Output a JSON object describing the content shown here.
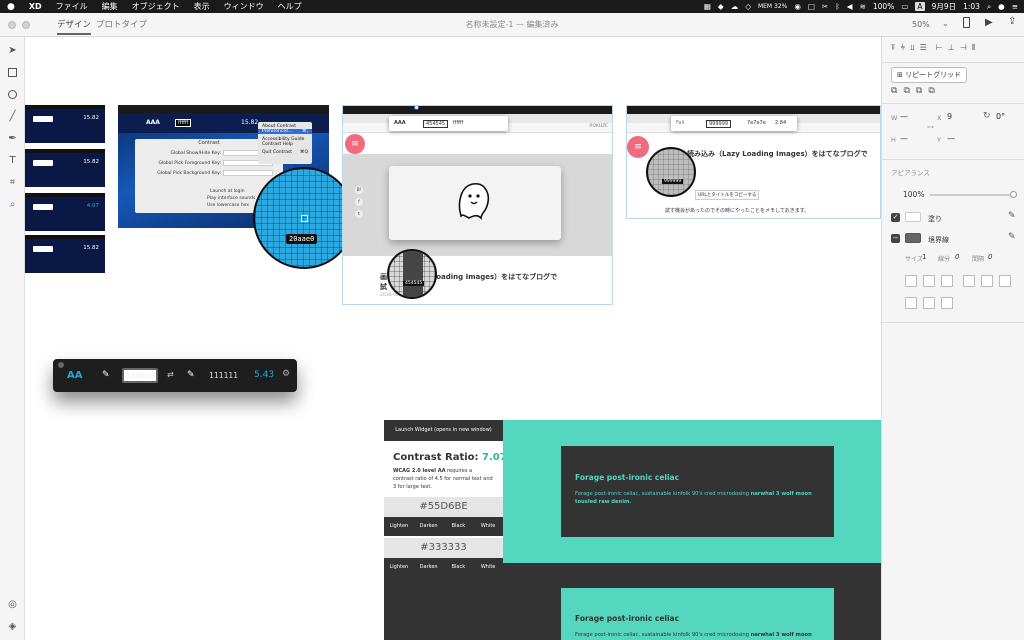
{
  "menubar": {
    "app": "XD",
    "items": [
      "ファイル",
      "編集",
      "オブジェクト",
      "表示",
      "ウィンドウ",
      "ヘルプ"
    ],
    "memory": "MEM 32%",
    "battery": "100%",
    "date": "9月9日",
    "time": "1:03"
  },
  "titlebar": {
    "tabs": [
      "デザイン",
      "プロトタイプ"
    ],
    "doc_title": "名称未設定-1 — 編集済み",
    "zoom": "50%"
  },
  "inspector": {
    "repeat_grid": "リピートグリッド",
    "w_label": "W",
    "w_value": "—",
    "h_label": "H",
    "h_value": "—",
    "x_label": "X",
    "x_value": "9",
    "y_label": "Y",
    "y_value": "—",
    "rotation": "0°",
    "appearance": "アピアランス",
    "opacity": "100%",
    "fill_label": "塗り",
    "border_label": "境界線",
    "size_label": "サイズ",
    "size_value": "1",
    "gap_label": "線分",
    "gap_value": "0",
    "interval_label": "間隔",
    "interval_value": "0"
  },
  "canvas": {
    "mini_values": [
      "15.82",
      "15.82",
      "4.07",
      "15.82"
    ],
    "contrast_dialog": {
      "title": "Contrast",
      "rows": [
        "Global Show/Hide Key:",
        "Global Pick Foreground Key:",
        "Global Pick Background Key:"
      ],
      "launch": "Launch at login",
      "sound": "Play interface sounds",
      "lower": "Use lowercase hex"
    },
    "context_menu": [
      "About Contrast",
      "Preferences...",
      "Accessibility Guide",
      "Contrast Help",
      "Quit Contrast"
    ],
    "context_shortcuts": [
      "",
      "⌘,",
      "",
      "",
      "⌘Q"
    ],
    "mini_toolbar": {
      "aaa": "AAA",
      "fg": "ffffff",
      "bg": "454545",
      "ratio": "15.82"
    },
    "magnifier_hex": "20aae0",
    "magnifier2_hex": "454545",
    "magnifier3_hex": "999999",
    "blog_url_bar": "ROKUZE",
    "blog_title": "画像の遅延読み込み（Lazy Loading Images）をはてなブログで試してみた",
    "blog_title_short": "画　　　（Lazy Loading Images）をはてなブログで",
    "blog_title_line2": "試",
    "blog_date": "2016-09-08",
    "blog_title_right": "読み込み（Lazy Loading Images）をはてなブログで",
    "blog_text_right": "試す機会があったのでその時にやったことをメモしておきます。",
    "copy_btn": "URLとタイトルをコピーする",
    "right_toolbar": {
      "fail": "Fail",
      "fg": "999999",
      "bg": "7e7e7e",
      "ratio": "2.84"
    },
    "contrast_panel": {
      "aa": "AA",
      "fg": "55d6be",
      "bg": "111111",
      "ratio": "5.43"
    },
    "widget": {
      "launch": "Launch Widget (opens in new window)",
      "ratio_label": "Contrast Ratio:",
      "ratio_value": "7.07",
      "wcag_bold": "WCAG 2.0 level AA",
      "wcag_rest": "requires a contrast ratio of 4.5 for normal text and 3 for large text.",
      "color1": "#55D6BE",
      "color2": "#333333",
      "buttons": [
        "Lighten",
        "Darken",
        "Black",
        "White"
      ]
    },
    "card_title": "Forage post-ironic celiac",
    "card_text_regular": "Forage post-ironic celiac, sustainable kinfolk 90's cred microdosing",
    "card_text_bold": "narwhal 3 wolf moon tousled raw denim.",
    "card_text_regular2": "Forage post-ironic celiac, sustainable kinfolk 90's cred microdosing",
    "card_text_bold2": "narwhal 3 wolf moon tousled raw denim."
  },
  "colors": {
    "teal": "#55d6be",
    "dark": "#333333",
    "blue": "#20aae0",
    "pink": "#f06b7e"
  }
}
